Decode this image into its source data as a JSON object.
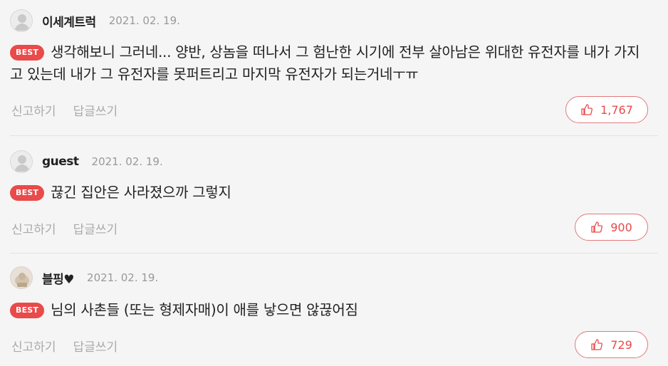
{
  "comments": [
    {
      "nickname": "이세계트럭",
      "date": "2021. 02. 19.",
      "badge": "BEST",
      "text": "생각해보니 그러네... 양반, 상놈을 떠나서 그 험난한 시기에 전부 살아남은 위대한 유전자를 내가 가지고 있는데 내가 그 유전자를 못퍼트리고 마지막 유전자가 되는거네ㅜㅠ",
      "report_label": "신고하기",
      "reply_label": "답글쓰기",
      "likes": "1,767",
      "avatar": "default-avatar-icon"
    },
    {
      "nickname": "guest",
      "date": "2021. 02. 19.",
      "badge": "BEST",
      "text": "끊긴 집안은 사라졌으까 그렇지",
      "report_label": "신고하기",
      "reply_label": "답글쓰기",
      "likes": "900",
      "avatar": "default-avatar-icon"
    },
    {
      "nickname": "블핑♥",
      "date": "2021. 02. 19.",
      "badge": "BEST",
      "text": "님의 사촌들 (또는 형제자매)이 애를 낳으면 않끊어짐",
      "report_label": "신고하기",
      "reply_label": "답글쓰기",
      "likes": "729",
      "avatar": "photo-avatar"
    }
  ],
  "colors": {
    "accent": "#e94a4a",
    "background": "#f5f5f5",
    "muted": "#aaaaaa"
  }
}
